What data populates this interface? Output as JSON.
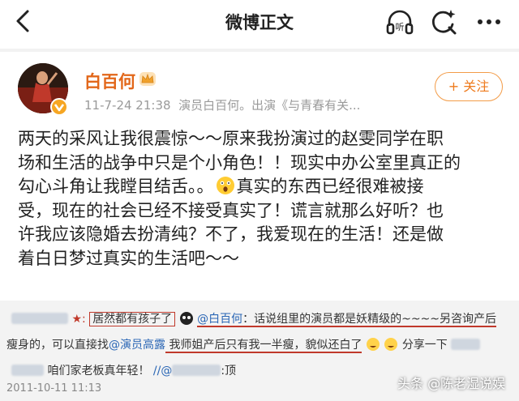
{
  "header": {
    "title": "微博正文",
    "back_icon": "back-arrow-icon",
    "listen_label": "听",
    "icons": [
      "headphone-listen-icon",
      "search-refresh-icon",
      "more-icon"
    ]
  },
  "author": {
    "name": "白百何",
    "badge_icon": "crown-icon",
    "verified_icon": "verified-v-icon",
    "timestamp": "11-7-24 21:38",
    "description": "演员白百何。出演《与青春有关...",
    "follow_label": "+ 关注"
  },
  "post": {
    "line1": "两天的采风让我很震惊～～原来我扮演过的赵雯同学在职",
    "line2": "场和生活的战争中只是个小角色！！现实中办公室里真正的",
    "line3a": "勾心斗角让我瞠目结舌。。",
    "emoji": "shocked-face-emoji",
    "line3b": "真实的东西已经很难被接",
    "line4": "受，现在的社会已经不接受真实了！谎言就那么好听？也",
    "line5": "许我应该隐婚去扮清纯？不了，我爱现在的生活！还是做",
    "line6": "着白日梦过真实的生活吧～～"
  },
  "embedded": {
    "row1_boxed": "居然都有孩子了",
    "row1_mention": "@白百何",
    "row1_text": "：话说组里的演员都是妖精级的~~~~另咨询产后",
    "row2_text_a": "瘦身的，可以直接找",
    "row2_mention": "@演员高露",
    "row2_text_b": " 我师姐产后只有我一半瘦，貌似还白了",
    "row2_text_c": "分享一下",
    "row3_text": "咱们家老板真年轻！",
    "row3_mention": "//@",
    "row3_suffix": ":顶",
    "timestamp": "2011-10-11 11:13"
  },
  "watermark": "头条 @陈老湿说娱"
}
